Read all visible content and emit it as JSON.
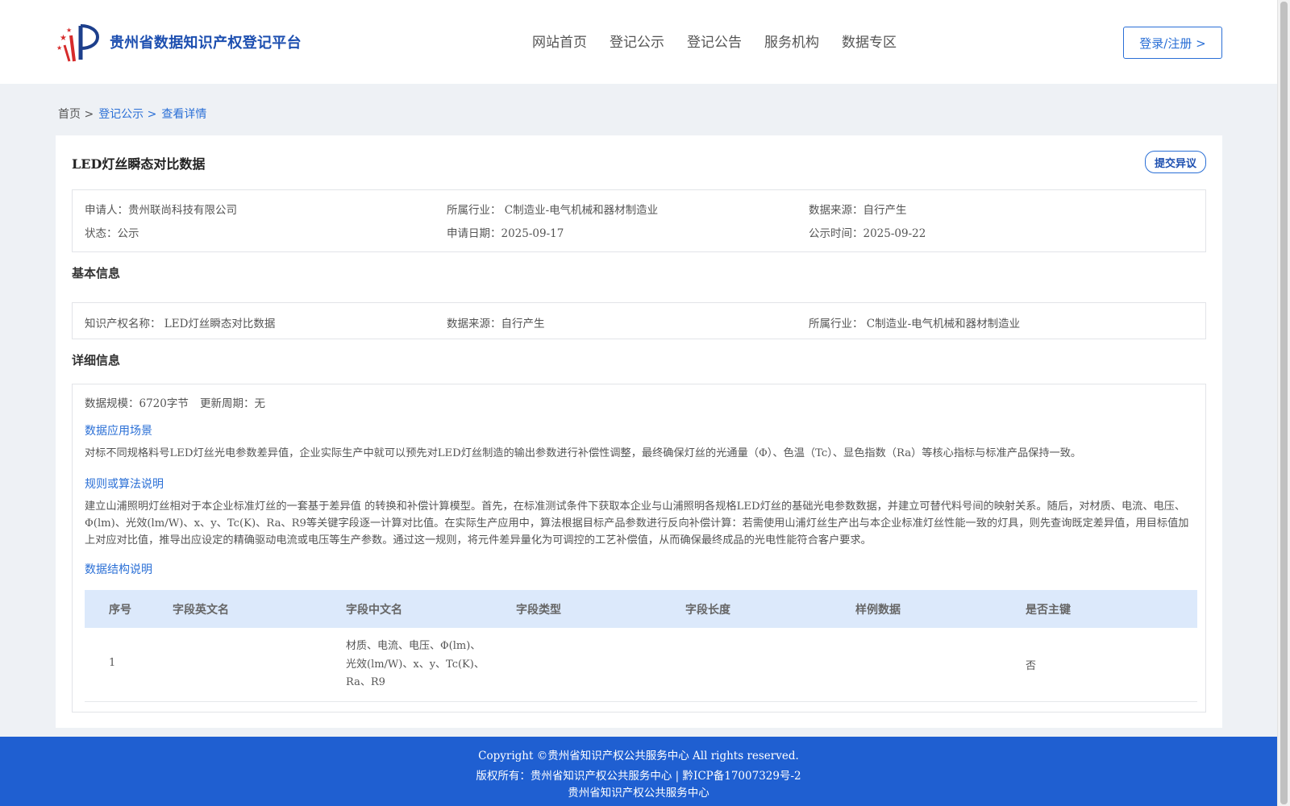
{
  "header": {
    "site_title": "贵州省数据知识产权登记平台",
    "nav": [
      "网站首页",
      "登记公示",
      "登记公告",
      "服务机构",
      "数据专区"
    ],
    "login_label": "登录/注册 >"
  },
  "breadcrumb": {
    "home": "首页 >",
    "level2": "登记公示 >",
    "current": "查看详情"
  },
  "record": {
    "title": "LED灯丝瞬态对比数据",
    "objection_label": "提交异议",
    "applicant": "申请人：贵州联尚科技有限公司",
    "industry": "所属行业： C制造业-电气机械和器材制造业",
    "data_source": "数据来源：自行产生",
    "status": "状态：公示",
    "apply_date": "申请日期：2025-09-17",
    "publish_date": "公示时间：2025-09-22"
  },
  "basic": {
    "section_title": "基本信息",
    "ip_name": "知识产权名称： LED灯丝瞬态对比数据",
    "data_source": "数据来源：自行产生",
    "industry": "所属行业： C制造业-电气机械和器材制造业"
  },
  "detail": {
    "section_title": "详细信息",
    "scale": "数据规模：6720字节",
    "update_cycle": "更新周期：无",
    "scenario_title": "数据应用场景",
    "scenario_text": "对标不同规格料号LED灯丝光电参数差异值，企业实际生产中就可以预先对LED灯丝制造的输出参数进行补偿性调整，最终确保灯丝的光通量（Φ）、色温（Tc）、显色指数（Ra）等核心指标与标准产品保持一致。",
    "rule_title": "规则或算法说明",
    "rule_text": "建立山浦照明灯丝相对于本企业标准灯丝的一套基于差异值 的转换和补偿计算模型。首先，在标准测试条件下获取本企业与山浦照明各规格LED灯丝的基础光电参数数据，并建立可替代料号间的映射关系。随后，对材质、电流、电压、Φ(lm)、光效(lm/W)、x、y、Tc(K)、Ra、R9等关键字段逐一计算对比值。在实际生产应用中，算法根据目标产品参数进行反向补偿计算：若需使用山浦灯丝生产出与本企业标准灯丝性能一致的灯具，则先查询既定差异值，用目标值加上对应对比值，推导出应设定的精确驱动电流或电压等生产参数。通过这一规则，将元件差异量化为可调控的工艺补偿值，从而确保最终成品的光电性能符合客户要求。",
    "structure_title": "数据结构说明",
    "table_headers": [
      "序号",
      "字段英文名",
      "字段中文名",
      "字段类型",
      "字段长度",
      "样例数据",
      "是否主键"
    ],
    "rows": [
      {
        "index": "1",
        "en_name": "",
        "cn_name_lines": [
          "材质、电流、电压、Φ(lm)、",
          "光效(lm/W)、x、y、Tc(K)、",
          "Ra、R9"
        ],
        "type": "",
        "length": "",
        "sample": "",
        "primary_key": "否"
      }
    ]
  },
  "footer": {
    "copyright": "Copyright ©贵州省知识产权公共服务中心 All rights reserved.",
    "owner": "版权所有：贵州省知识产权公共服务中心 | 黔ICP备17007329号-2",
    "org": "贵州省知识产权公共服务中心"
  }
}
